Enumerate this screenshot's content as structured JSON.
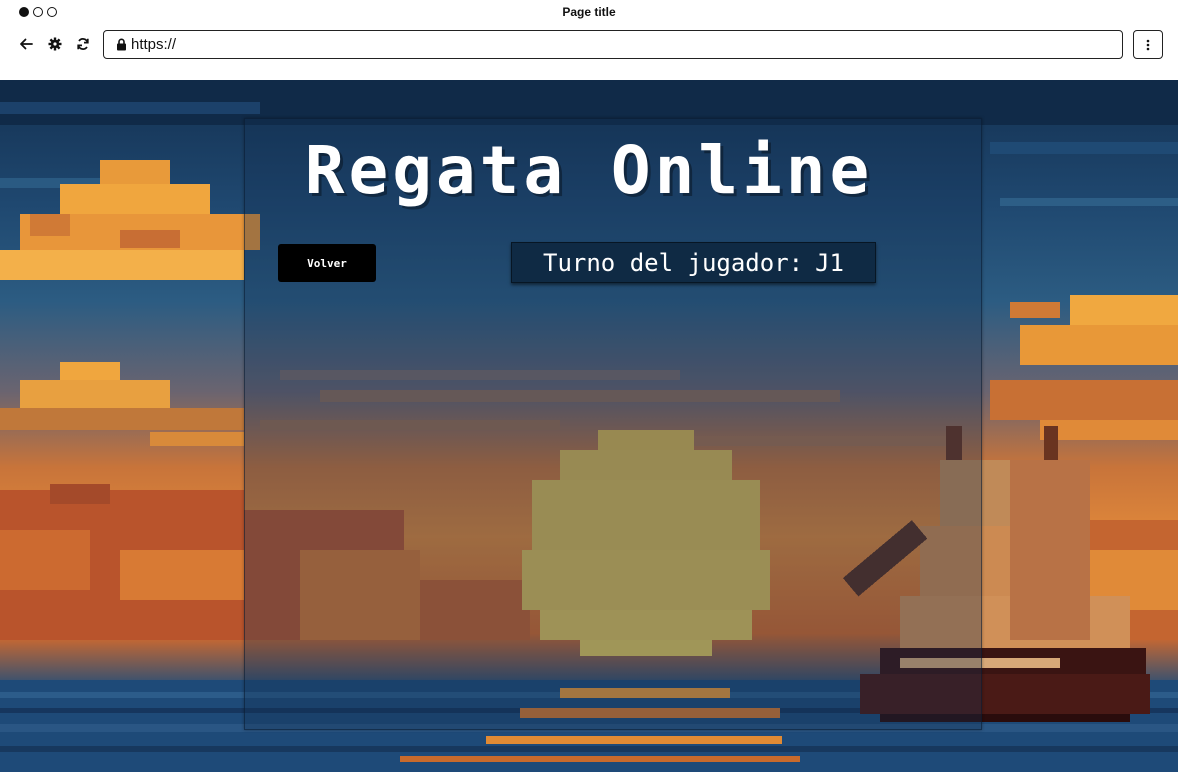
{
  "browser": {
    "title": "Page title",
    "url": "https://",
    "icons": {
      "back": "arrow-left-icon",
      "settings": "gear-icon",
      "reload": "reload-icon",
      "lock": "lock-icon",
      "menu": "kebab-menu-icon"
    }
  },
  "game": {
    "title": "Regata Online",
    "back_label": "Volver",
    "turn_label": "Turno del jugador:",
    "turn_player": "J1"
  },
  "colors": {
    "panel_overlay": "#143050",
    "back_button": "#000000",
    "turn_box": "#0f2a44",
    "sun": "#d8b64e",
    "sky_top": "#143152",
    "cloud_orange": "#e8963a"
  }
}
